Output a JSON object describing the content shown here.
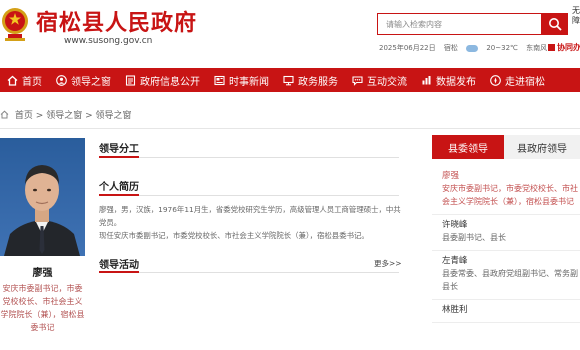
{
  "header": {
    "site_title": "宿松县人民政府",
    "site_url": "www.susong.gov.cn",
    "search_placeholder": "请输入检索内容",
    "top_links": "无障",
    "date": "2025年06月22日",
    "location": "宿松",
    "temperature": "20~32℃",
    "wind": "东南风",
    "collab_link": "协同办"
  },
  "nav": {
    "items": [
      {
        "label": "首页",
        "icon": "home-icon"
      },
      {
        "label": "领导之窗",
        "icon": "person-icon"
      },
      {
        "label": "政府信息公开",
        "icon": "document-icon"
      },
      {
        "label": "时事新闻",
        "icon": "newspaper-icon"
      },
      {
        "label": "政务服务",
        "icon": "monitor-icon"
      },
      {
        "label": "互动交流",
        "icon": "chat-icon"
      },
      {
        "label": "数据发布",
        "icon": "chart-icon"
      },
      {
        "label": "走进宿松",
        "icon": "compass-icon"
      }
    ]
  },
  "breadcrumb": {
    "home": "首页",
    "separator": ">",
    "level1": "领导之窗",
    "level2": "领导之窗"
  },
  "profile": {
    "name": "廖强",
    "title": "安庆市委副书记，市委党校校长、市社会主义学院院长（兼），宿松县委书记"
  },
  "sections": {
    "division_title": "领导分工",
    "bio_title": "个人简历",
    "bio_line1": "廖强，男，汉族，1976年11月生，省委党校研究生学历，高级管理人员工商管理硕士，中共党员。",
    "bio_line2": "现任安庆市委副书记，市委党校校长、市社会主义学院院长（兼），宿松县委书记。",
    "activities_title": "领导活动",
    "more_label": "更多>>"
  },
  "right_panel": {
    "tab_active": "县委领导",
    "tab_inactive": "县政府领导",
    "leaders": [
      {
        "name": "廖强",
        "position": "安庆市委副书记，市委党校校长、市社会主义学院院长（兼），宿松县委书记"
      },
      {
        "name": "许晓峰",
        "position": "县委副书记、县长"
      },
      {
        "name": "左青峰",
        "position": "县委常委、县政府党组副书记、常务副县长"
      },
      {
        "name": "林胜利",
        "position": ""
      }
    ]
  },
  "colors": {
    "brand_red": "#c81414",
    "nav_bg": "#c81414"
  }
}
